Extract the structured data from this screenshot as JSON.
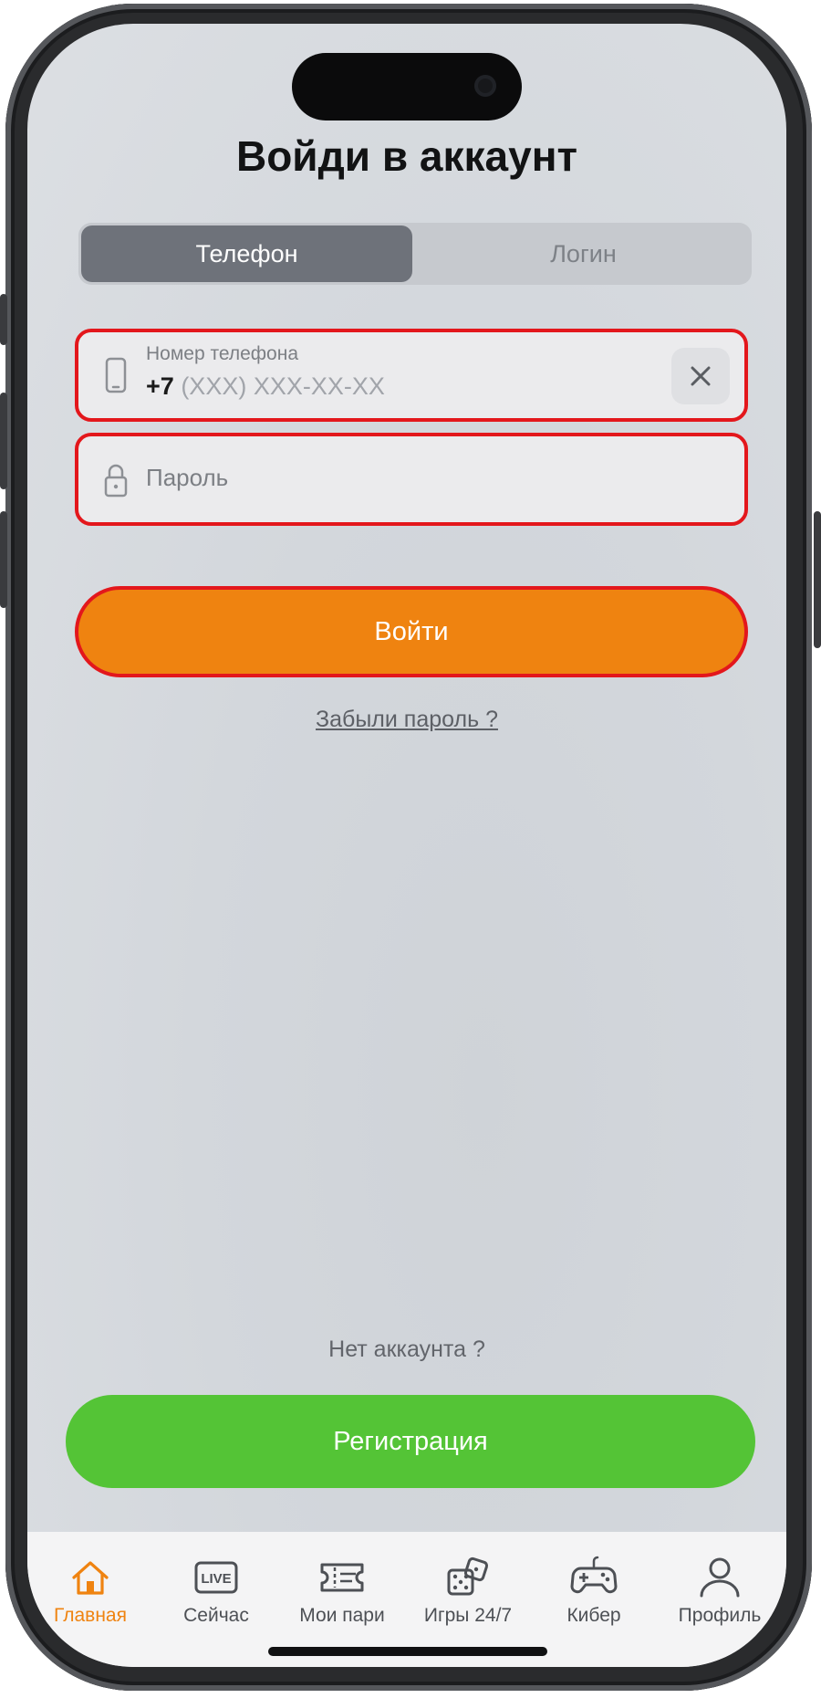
{
  "screen": {
    "title": "Войди в аккаунт"
  },
  "tabs": [
    {
      "label": "Телефон",
      "active": true
    },
    {
      "label": "Логин",
      "active": false
    }
  ],
  "phone_field": {
    "label": "Номер телефона",
    "prefix": "+7",
    "mask": "(XXX) XXX-XX-XX",
    "icon": "phone-icon",
    "clear_icon": "close-icon"
  },
  "password_field": {
    "placeholder": "Пароль",
    "icon": "lock-icon"
  },
  "login_button": {
    "label": "Войти"
  },
  "forgot_link": {
    "label": "Забыли пароль ?"
  },
  "register": {
    "prompt": "Нет аккаунта ?",
    "button_label": "Регистрация"
  },
  "bottom_nav": {
    "items": [
      {
        "label": "Главная",
        "icon": "home-icon",
        "active": true
      },
      {
        "label": "Сейчас",
        "icon": "live-icon",
        "badge": "LIVE",
        "active": false
      },
      {
        "label": "Мои пари",
        "icon": "ticket-icon",
        "active": false
      },
      {
        "label": "Игры 24/7",
        "icon": "dice-icon",
        "active": false
      },
      {
        "label": "Кибер",
        "icon": "gamepad-icon",
        "active": false
      },
      {
        "label": "Профиль",
        "icon": "user-icon",
        "active": false
      }
    ]
  },
  "colors": {
    "accent_orange": "#ef8310",
    "error_red": "#e3171c",
    "register_green": "#54c436",
    "active_tab": "#6e727a"
  }
}
